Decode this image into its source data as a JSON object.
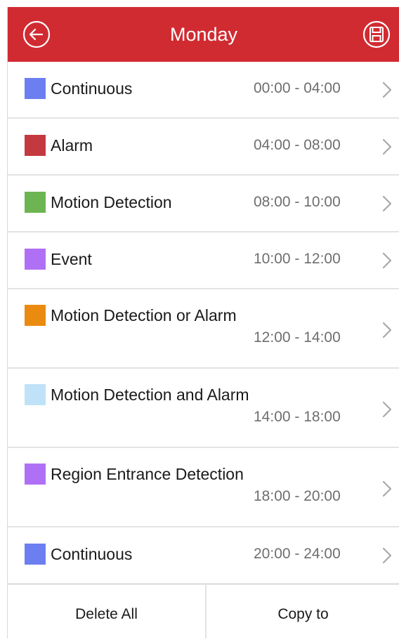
{
  "header": {
    "title": "Monday",
    "back_icon": "back-arrow-circle-icon",
    "save_icon": "save-circle-icon",
    "bg_color": "#d12b32"
  },
  "schedule": [
    {
      "type": "Continuous",
      "time": "00:00 - 04:00",
      "color": "#6b7ff0"
    },
    {
      "type": "Alarm",
      "time": "04:00 - 08:00",
      "color": "#c4393f"
    },
    {
      "type": "Motion Detection",
      "time": "08:00 - 10:00",
      "color": "#6cb552"
    },
    {
      "type": "Event",
      "time": "10:00 - 12:00",
      "color": "#b070f5"
    },
    {
      "type": "Motion Detection or Alarm",
      "time": "12:00 - 14:00",
      "color": "#ea8b0f"
    },
    {
      "type": "Motion Detection and Alarm",
      "time": "14:00 - 18:00",
      "color": "#bfe2f8"
    },
    {
      "type": "Region Entrance Detection",
      "time": "18:00 - 20:00",
      "color": "#b070f5"
    },
    {
      "type": "Continuous",
      "time": "20:00 - 24:00",
      "color": "#6b7ff0"
    }
  ],
  "footer": {
    "delete_all_label": "Delete All",
    "copy_to_label": "Copy to"
  }
}
